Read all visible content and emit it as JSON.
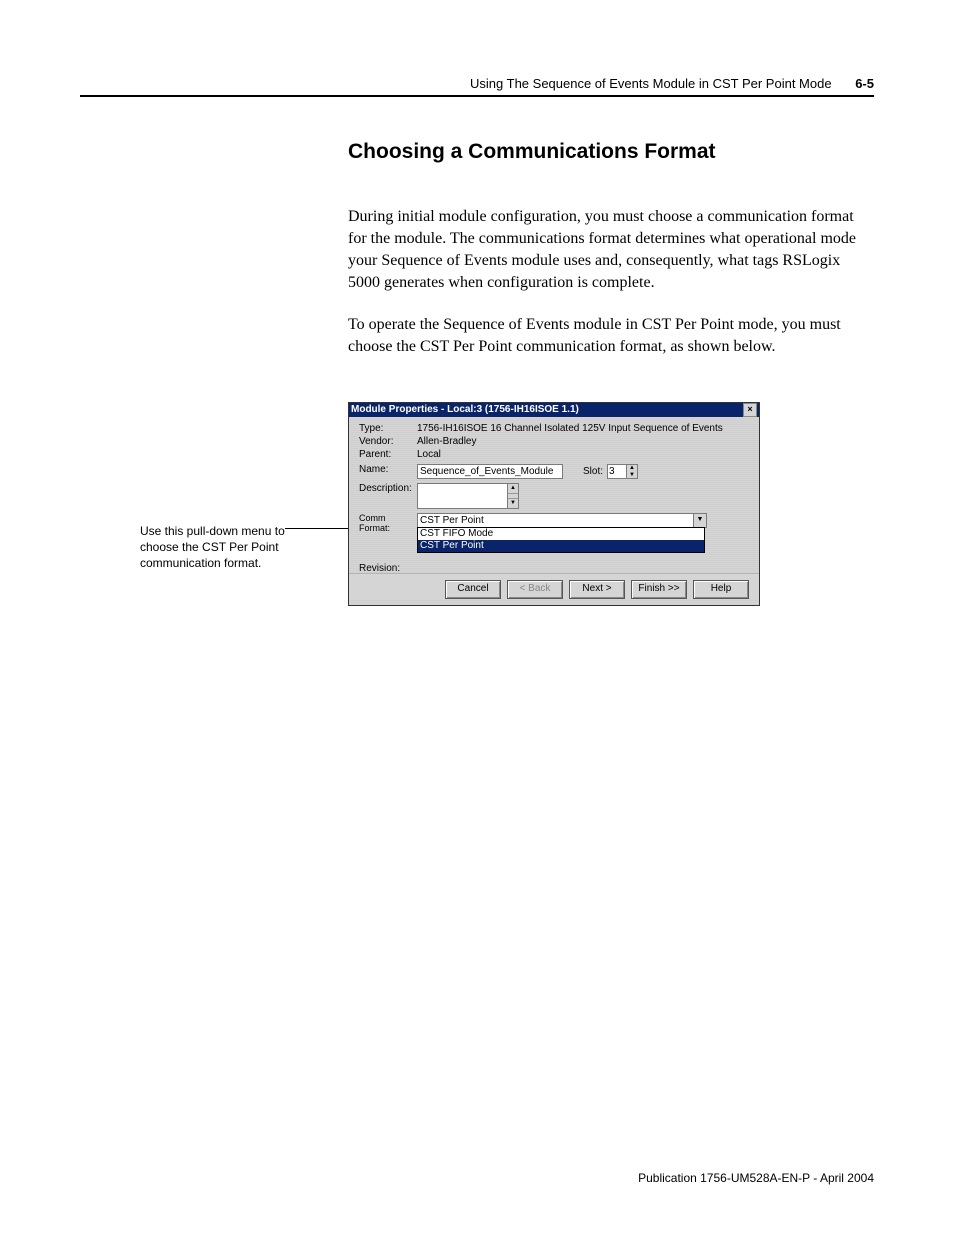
{
  "header": {
    "chapter_title": "Using The Sequence of Events Module in CST Per Point Mode",
    "page_number": "6-5"
  },
  "section": {
    "title": "Choosing a Communications Format",
    "paragraphs": [
      "During initial module configuration, you must choose a communication format for the module. The communications format determines what operational mode your Sequence of Events module uses and, consequently, what tags RSLogix 5000 generates when configuration is complete.",
      "To operate the Sequence of Events module in CST Per Point mode, you must choose the CST Per Point communication format, as shown below."
    ]
  },
  "annotation": "Use this pull-down menu to choose the CST Per Point communication format.",
  "dialog": {
    "title": "Module Properties - Local:3 (1756-IH16ISOE 1.1)",
    "labels": {
      "type": "Type:",
      "vendor": "Vendor:",
      "parent": "Parent:",
      "name": "Name:",
      "slot": "Slot:",
      "description": "Description:",
      "comm_format": "Comm Format:",
      "revision": "Revision:"
    },
    "values": {
      "type": "1756-IH16ISOE 16 Channel Isolated 125V Input Sequence of Events",
      "vendor": "Allen-Bradley",
      "parent": "Local",
      "name": "Sequence_of_Events_Module",
      "slot": "3"
    },
    "comm_format": {
      "selected": "CST Per Point",
      "options": [
        "CST FIFO Mode",
        "CST Per Point"
      ]
    },
    "buttons": {
      "cancel": "Cancel",
      "back": "< Back",
      "next": "Next >",
      "finish": "Finish >>",
      "help": "Help"
    }
  },
  "footer": "Publication 1756-UM528A-EN-P - April 2004"
}
